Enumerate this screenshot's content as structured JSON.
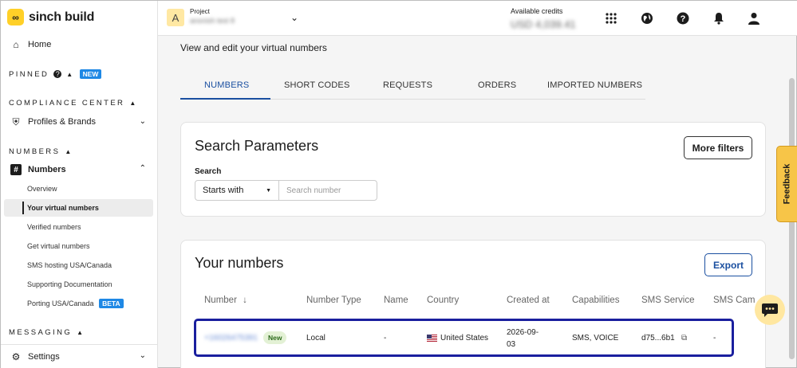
{
  "brand": {
    "logo_text": "sinch build"
  },
  "sidebar": {
    "home": "Home",
    "pinned": {
      "title": "PINNED",
      "badge": "NEW"
    },
    "compliance": {
      "title": "COMPLIANCE CENTER",
      "profiles": "Profiles & Brands"
    },
    "numbers_section": {
      "title": "NUMBERS",
      "numbers": "Numbers"
    },
    "sub_items": [
      "Overview",
      "Your virtual numbers",
      "Verified numbers",
      "Get virtual numbers",
      "SMS hosting USA/Canada",
      "Supporting Documentation",
      "Porting USA/Canada"
    ],
    "porting_badge": "BETA",
    "messaging": {
      "title": "MESSAGING"
    },
    "settings": "Settings"
  },
  "topbar": {
    "project_initial": "A",
    "project_label": "Project",
    "project_name": "anonish test 8",
    "credits_label": "Available credits",
    "credits_value": "USD 4,039.41"
  },
  "main": {
    "subtitle": "View and edit your virtual numbers",
    "tabs": [
      "NUMBERS",
      "SHORT CODES",
      "REQUESTS",
      "ORDERS",
      "IMPORTED NUMBERS"
    ],
    "search_card": {
      "title": "Search Parameters",
      "more_filters": "More filters",
      "search_label": "Search",
      "select_value": "Starts with",
      "search_placeholder": "Search number"
    },
    "numbers_card": {
      "title": "Your numbers",
      "export": "Export",
      "columns": [
        "Number",
        "Number Type",
        "Name",
        "Country",
        "Created at",
        "Capabilities",
        "SMS Service",
        "SMS Cam"
      ],
      "row": {
        "number": "+16026475391",
        "badge": "New",
        "type": "Local",
        "name": "-",
        "country": "United States",
        "created_line1": "2026-09-",
        "created_line2": "03",
        "capabilities": "SMS, VOICE",
        "sms_service": "d75...6b1",
        "sms_campaign": "-"
      }
    }
  },
  "widgets": {
    "feedback": "Feedback"
  }
}
